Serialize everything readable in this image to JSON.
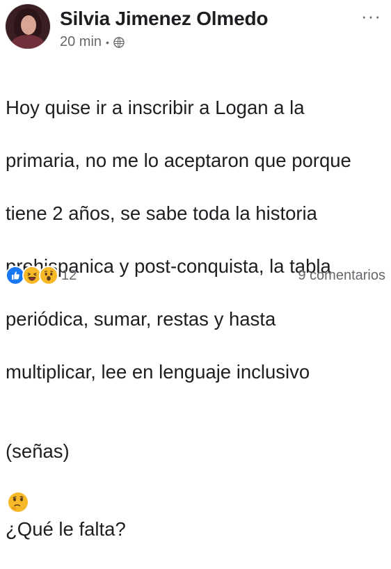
{
  "post": {
    "author_name": "Silvia Jimenez Olmedo",
    "time": "20 min",
    "separator": "•",
    "privacy_icon": "globe-icon",
    "more_icon": "ellipsis-icon",
    "more_label": "···",
    "text_lines": [
      "Hoy quise ir a inscribir a Logan a la",
      "primaria, no me lo aceptaron que porque",
      "tiene 2 años, se sabe toda la historia",
      "prehispanica y post-conquista, la tabla",
      "periódica, sumar, restas y hasta",
      "multiplicar, lee en lenguaje inclusivo"
    ],
    "last_line_start": "(señas)",
    "last_line_emoji": "thinking-face-icon",
    "last_line_end": "¿Qué le falta?",
    "reaction_icons": [
      "like-icon",
      "haha-icon",
      "wow-icon"
    ],
    "reaction_count": "12",
    "comments_count": "9 comentarios"
  },
  "colors": {
    "text": "#1c1e21",
    "secondary": "#65676b",
    "like": "#1877f2",
    "emoji": "#f7b928"
  }
}
